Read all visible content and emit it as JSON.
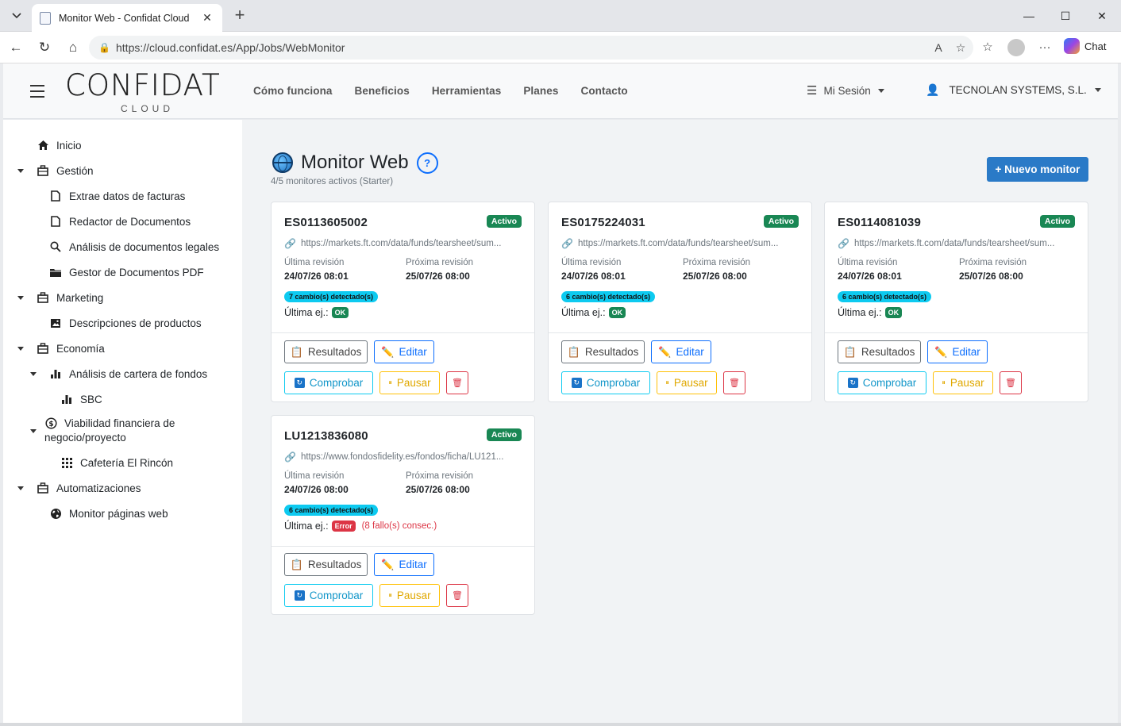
{
  "browser": {
    "tab_title": "Monitor Web - Confidat Cloud",
    "url": "https://cloud.confidat.es/App/Jobs/WebMonitor",
    "chat_label": "Chat"
  },
  "header": {
    "logo_main": "CONFIDAT",
    "logo_sub": "CLOUD",
    "nav": [
      "Cómo funciona",
      "Beneficios",
      "Herramientas",
      "Planes",
      "Contacto"
    ],
    "session_label": "Mi Sesión",
    "company_label": "TECNOLAN SYSTEMS, S.L."
  },
  "sidebar": {
    "items": [
      {
        "label": "Inicio",
        "icon": "home-icon"
      },
      {
        "label": "Gestión",
        "icon": "briefcase-icon"
      },
      {
        "label": "Extrae datos de facturas",
        "icon": "document-icon"
      },
      {
        "label": "Redactor de Documentos",
        "icon": "document-icon"
      },
      {
        "label": "Análisis de documentos legales",
        "icon": "search-icon"
      },
      {
        "label": "Gestor de Documentos PDF",
        "icon": "folder-icon"
      },
      {
        "label": "Marketing",
        "icon": "briefcase-icon"
      },
      {
        "label": "Descripciones de productos",
        "icon": "image-icon"
      },
      {
        "label": "Economía",
        "icon": "briefcase-icon"
      },
      {
        "label": "Análisis de cartera de fondos",
        "icon": "bar-chart-icon"
      },
      {
        "label": "SBC",
        "icon": "bar-chart-icon"
      },
      {
        "label": "Viabilidad financiera de",
        "label2": "negocio/proyecto",
        "icon": "dollar-icon"
      },
      {
        "label": "Cafetería El Rincón",
        "icon": "grid-icon"
      },
      {
        "label": "Automatizaciones",
        "icon": "briefcase-icon"
      },
      {
        "label": "Monitor páginas web",
        "icon": "globe-icon"
      }
    ]
  },
  "main": {
    "title": "Monitor Web",
    "help": "?",
    "subtitle": "4/5 monitores activos (Starter)",
    "new_button": "+ Nuevo monitor",
    "labels": {
      "last_review": "Última revisión",
      "next_review": "Próxima revisión",
      "last_run": "Última ej.:",
      "results": "Resultados",
      "edit": "Editar",
      "check": "Comprobar",
      "pause": "Pausar"
    },
    "cards": [
      {
        "code": "ES0113605002",
        "status": "Activo",
        "url": "https://markets.ft.com/data/funds/tearsheet/sum...",
        "last_review": "24/07/26 08:01",
        "next_review": "25/07/26 08:00",
        "changes": "7 cambio(s) detectado(s)",
        "run_status": "OK",
        "run_error": ""
      },
      {
        "code": "ES0175224031",
        "status": "Activo",
        "url": "https://markets.ft.com/data/funds/tearsheet/sum...",
        "last_review": "24/07/26 08:01",
        "next_review": "25/07/26 08:00",
        "changes": "6 cambio(s) detectado(s)",
        "run_status": "OK",
        "run_error": ""
      },
      {
        "code": "ES0114081039",
        "status": "Activo",
        "url": "https://markets.ft.com/data/funds/tearsheet/sum...",
        "last_review": "24/07/26 08:01",
        "next_review": "25/07/26 08:00",
        "changes": "6 cambio(s) detectado(s)",
        "run_status": "OK",
        "run_error": ""
      },
      {
        "code": "LU1213836080",
        "status": "Activo",
        "url": "https://www.fondosfidelity.es/fondos/ficha/LU121...",
        "last_review": "24/07/26 08:00",
        "next_review": "25/07/26 08:00",
        "changes": "6 cambio(s) detectado(s)",
        "run_status": "Error",
        "run_error": "(8 fallo(s) consec.)"
      }
    ]
  },
  "colors": {
    "primary": "#0d6efd",
    "success": "#198754",
    "danger": "#dc3545",
    "info": "#0dcaf0",
    "warning": "#ffc107",
    "new_button": "#2a7ac7"
  }
}
